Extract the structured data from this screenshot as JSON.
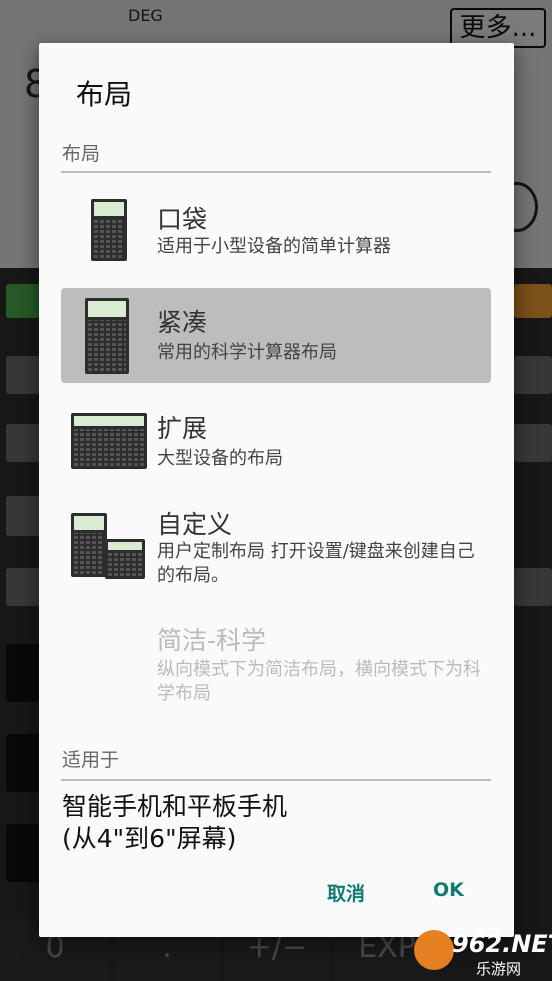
{
  "background": {
    "angle_mode": "DEG",
    "more_label": "更多...",
    "display_digit": "8",
    "bottom_keys": [
      "0",
      ".",
      "+/−",
      "EXP"
    ]
  },
  "dialog": {
    "title": "布局",
    "layout_section_label": "布局",
    "options": [
      {
        "title": "口袋",
        "description": "适用于小型设备的简单计算器",
        "selected": false,
        "enabled": true
      },
      {
        "title": "紧凑",
        "description": "常用的科学计算器布局",
        "selected": true,
        "enabled": true
      },
      {
        "title": "扩展",
        "description": "大型设备的布局",
        "selected": false,
        "enabled": true
      },
      {
        "title": "自定义",
        "description": "用户定制布局 打开设置/键盘来创建自己的布局。",
        "selected": false,
        "enabled": true
      },
      {
        "title": "简洁-科学",
        "description": "纵向模式下为简洁布局，横向模式下为科学布局",
        "selected": false,
        "enabled": false
      }
    ],
    "applies_label": "适用于",
    "applies_value_line1": "智能手机和平板手机",
    "applies_value_line2": "(从4\"到6\"屏幕)",
    "cancel_label": "取消",
    "ok_label": "OK"
  },
  "watermark": {
    "text": "962.NET",
    "subtext": "乐游网"
  },
  "colors": {
    "accent": "#117a72",
    "selected_row": "#bdbdbd",
    "dialog_bg": "#fafafa"
  }
}
